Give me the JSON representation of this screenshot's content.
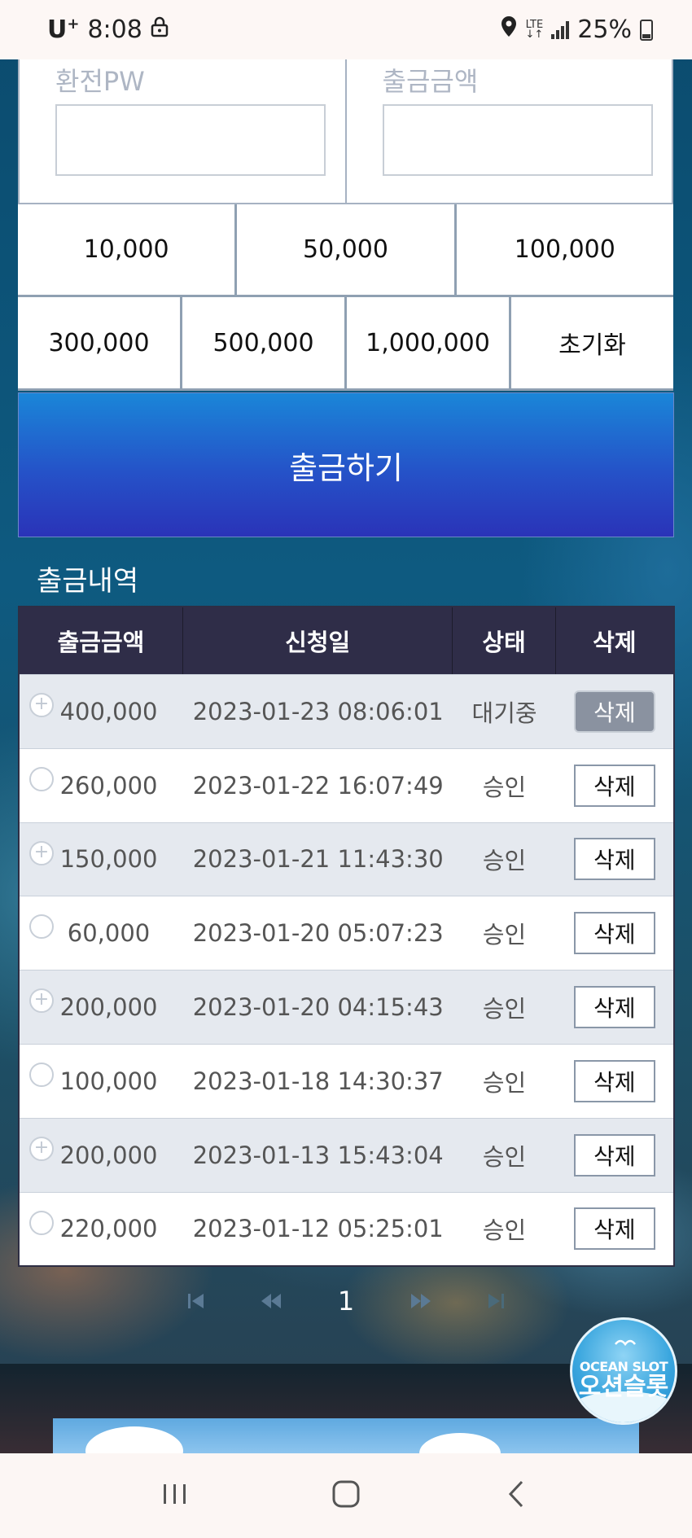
{
  "status_bar": {
    "carrier": "U",
    "carrier_sup": "+",
    "time": "8:08",
    "network": "LTE",
    "battery": "25%"
  },
  "form": {
    "pw_label": "환전PW",
    "amount_label": "출금금액"
  },
  "amount_buttons": {
    "row1": [
      "10,000",
      "50,000",
      "100,000"
    ],
    "row2": [
      "300,000",
      "500,000",
      "1,000,000",
      "초기화"
    ]
  },
  "withdraw_label": "출금하기",
  "history": {
    "title": "출금내역",
    "headers": [
      "출금금액",
      "신청일",
      "상태",
      "삭제"
    ],
    "rows": [
      {
        "amount": "400,000",
        "date": "2023-01-23 08:06:01",
        "status": "대기중",
        "action": "삭제"
      },
      {
        "amount": "260,000",
        "date": "2023-01-22 16:07:49",
        "status": "승인",
        "action": "삭제"
      },
      {
        "amount": "150,000",
        "date": "2023-01-21 11:43:30",
        "status": "승인",
        "action": "삭제"
      },
      {
        "amount": "60,000",
        "date": "2023-01-20 05:07:23",
        "status": "승인",
        "action": "삭제"
      },
      {
        "amount": "200,000",
        "date": "2023-01-20 04:15:43",
        "status": "승인",
        "action": "삭제"
      },
      {
        "amount": "100,000",
        "date": "2023-01-18 14:30:37",
        "status": "승인",
        "action": "삭제"
      },
      {
        "amount": "200,000",
        "date": "2023-01-13 15:43:04",
        "status": "승인",
        "action": "삭제"
      },
      {
        "amount": "220,000",
        "date": "2023-01-12 05:25:01",
        "status": "승인",
        "action": "삭제"
      }
    ]
  },
  "pagination": {
    "current_page": "1"
  },
  "logo": {
    "en": "OCEAN SLOT",
    "ko": "오션슬롯"
  }
}
